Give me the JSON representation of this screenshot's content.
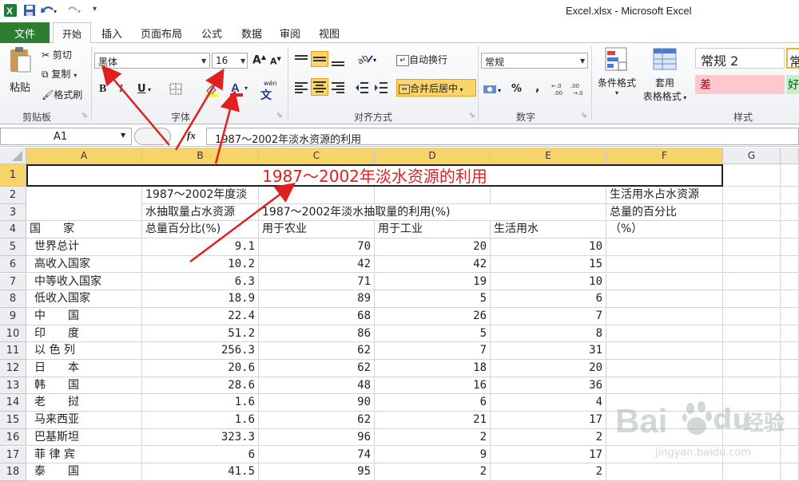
{
  "window": {
    "title": "Excel.xlsx - Microsoft Excel"
  },
  "tabs": [
    "文件",
    "开始",
    "插入",
    "页面布局",
    "公式",
    "数据",
    "审阅",
    "视图"
  ],
  "clipboard": {
    "paste": "粘贴",
    "cut": "剪切",
    "copy": "复制",
    "format_painter": "格式刷",
    "group": "剪贴板"
  },
  "font": {
    "name": "黑体",
    "size": "16",
    "bold": "B",
    "italic": "I",
    "underline": "U",
    "group": "字体",
    "wen": "wén"
  },
  "alignment": {
    "wrap": "自动换行",
    "merge": "合并后居中",
    "group": "对齐方式"
  },
  "number": {
    "format": "常规",
    "percent": "%",
    "comma": ",",
    "group": "数字"
  },
  "styles": {
    "conditional": "条件格式",
    "table_format_1": "套用",
    "table_format_2": "表格格式",
    "normal2": "常规 2",
    "normal": "常",
    "bad": "差",
    "good": "好",
    "group": "样式"
  },
  "formula_bar": {
    "name_box": "A1",
    "fx": "fx",
    "content": "1987～2002年淡水资源的利用"
  },
  "columns": [
    "A",
    "B",
    "C",
    "D",
    "E",
    "F",
    "G"
  ],
  "rows": [
    "1",
    "2",
    "3",
    "4",
    "5",
    "6",
    "7",
    "8",
    "9",
    "10",
    "11",
    "12",
    "13",
    "14",
    "15",
    "16",
    "17",
    "18"
  ],
  "sheet": {
    "title": "1987～2002年淡水资源的利用",
    "b_header": [
      "1987～2002年度淡",
      "水抽取量占水资源",
      "总量百分比(%)"
    ],
    "c_header": "1987～2002年淡水抽取量的利用(%)",
    "f_header": [
      "生活用水占水资源",
      "总量的百分比",
      "（%）"
    ],
    "a4": "国　　家",
    "c4": "用于农业",
    "d4": "用于工业",
    "e4": "生活用水",
    "data": [
      [
        "世界总计",
        "9.1",
        "70",
        "20",
        "10"
      ],
      [
        "高收入国家",
        "10.2",
        "42",
        "42",
        "15"
      ],
      [
        "中等收入国家",
        "6.3",
        "71",
        "19",
        "10"
      ],
      [
        "低收入国家",
        "18.9",
        "89",
        "5",
        "6"
      ],
      [
        "中　　国",
        "22.4",
        "68",
        "26",
        "7"
      ],
      [
        "印　　度",
        "51.2",
        "86",
        "5",
        "8"
      ],
      [
        "以 色 列",
        "256.3",
        "62",
        "7",
        "31"
      ],
      [
        "日　　本",
        "20.6",
        "62",
        "18",
        "20"
      ],
      [
        "韩　　国",
        "28.6",
        "48",
        "16",
        "36"
      ],
      [
        "老　　挝",
        "1.6",
        "90",
        "6",
        "4"
      ],
      [
        "马来西亚",
        "1.6",
        "62",
        "21",
        "17"
      ],
      [
        "巴基斯坦",
        "323.3",
        "96",
        "2",
        "2"
      ],
      [
        "菲 律 宾",
        "6",
        "74",
        "9",
        "17"
      ],
      [
        "泰　　国",
        "41.5",
        "95",
        "2",
        "2"
      ]
    ]
  },
  "watermark": {
    "brand": "Bai",
    "brand2": "du",
    "cn": "经验",
    "url": "jingyan.baidu.com"
  },
  "colors": {
    "accent_red": "#e02020",
    "file_tab": "#2e7d32",
    "selected_header": "#f7d46a",
    "bad_fill": "#ffc7ce",
    "good_fill": "#c6efce"
  }
}
